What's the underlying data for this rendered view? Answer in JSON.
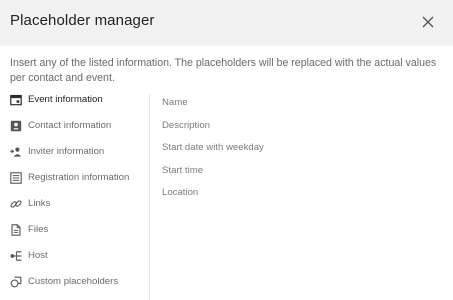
{
  "dialog": {
    "title": "Placeholder manager",
    "close_icon": "close-icon",
    "description": "Insert any of the listed information. The placeholders will be replaced with the actual values per contact and event."
  },
  "sidebar": {
    "active": "Event information",
    "items": [
      {
        "label": "Event information",
        "icon": "event-calendar-icon"
      },
      {
        "label": "Contact information",
        "icon": "contact-card-icon"
      },
      {
        "label": "Inviter information",
        "icon": "person-add-icon"
      },
      {
        "label": "Registration information",
        "icon": "registration-list-icon"
      },
      {
        "label": "Links",
        "icon": "link-icon"
      },
      {
        "label": "Files",
        "icon": "file-icon"
      },
      {
        "label": "Host",
        "icon": "host-tree-icon"
      },
      {
        "label": "Custom placeholders",
        "icon": "custom-placeholder-icon"
      }
    ]
  },
  "content": {
    "fields": [
      {
        "label": "Name"
      },
      {
        "label": "Description"
      },
      {
        "label": "Start date with weekday"
      },
      {
        "label": "Start time"
      },
      {
        "label": "Location"
      }
    ]
  }
}
